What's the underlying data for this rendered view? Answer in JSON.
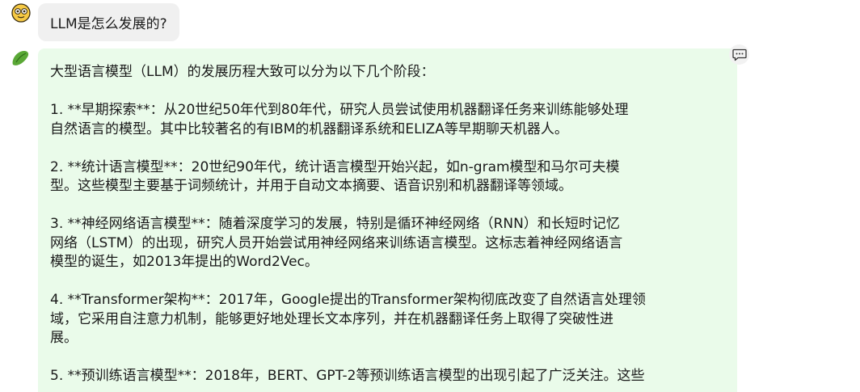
{
  "user_message": {
    "text": "LLM是怎么发展的?"
  },
  "assistant_message": {
    "paragraphs": [
      [
        "大型语言模型（LLM）的发展历程大致可以分为以下几个阶段："
      ],
      [
        "1. **早期探索**：从20世纪50年代到80年代，研究人员尝试使用机器翻译任务来训练能够处理",
        "自然语言的模型。其中比较著名的有IBM的机器翻译系统和ELIZA等早期聊天机器人。"
      ],
      [
        "2. **统计语言模型**：20世纪90年代，统计语言模型开始兴起，如n-gram模型和马尔可夫模",
        "型。这些模型主要基于词频统计，并用于自动文本摘要、语音识别和机器翻译等领域。"
      ],
      [
        "3. **神经网络语言模型**：随着深度学习的发展，特别是循环神经网络（RNN）和长短时记忆",
        "网络（LSTM）的出现，研究人员开始尝试用神经网络来训练语言模型。这标志着神经网络语言",
        "模型的诞生，如2013年提出的Word2Vec。"
      ],
      [
        "4. **Transformer架构**：2017年，Google提出的Transformer架构彻底改变了自然语言处理领",
        "域，它采用自注意力机制，能够更好地处理长文本序列，并在机器翻译任务上取得了突破性进",
        "展。"
      ],
      [
        "5. **预训练语言模型**：2018年，BERT、GPT-2等预训练语言模型的出现引起了广泛关注。这些"
      ]
    ]
  },
  "icons": {
    "user_avatar": "emoji-face-icon",
    "bot_avatar": "bean-icon",
    "comment": "chat-bubble-icon"
  }
}
